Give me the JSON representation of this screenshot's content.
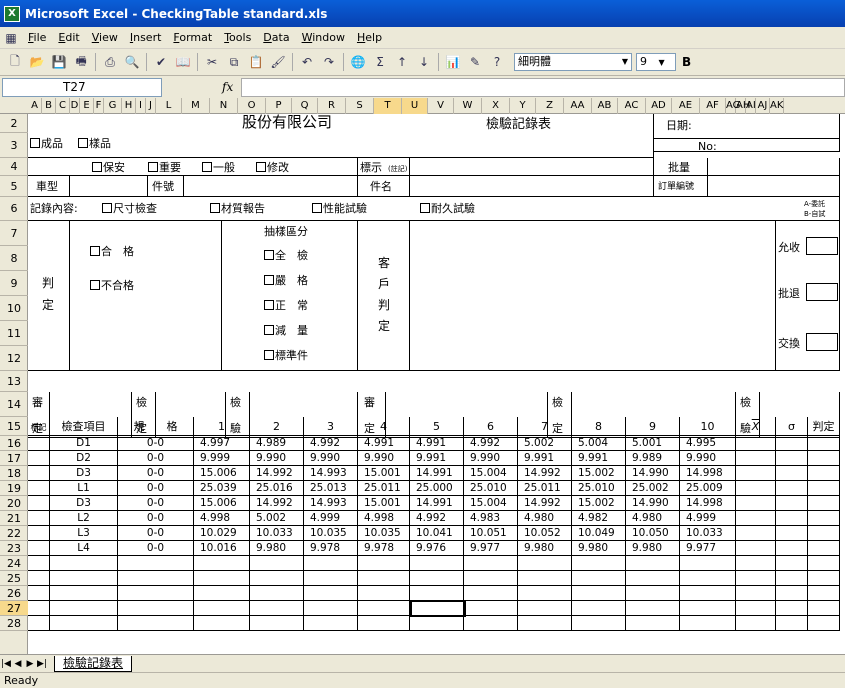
{
  "window": {
    "title": "Microsoft Excel - CheckingTable  standard.xls"
  },
  "menu": [
    "File",
    "Edit",
    "View",
    "Insert",
    "Format",
    "Tools",
    "Data",
    "Window",
    "Help"
  ],
  "toolbar": {
    "font": "細明體",
    "size": "9",
    "bold_label": "B"
  },
  "formula": {
    "cell_ref": "T27",
    "fx_label": "fx"
  },
  "columns": [
    "A",
    "B",
    "C",
    "D",
    "E",
    "F",
    "G",
    "H",
    "I",
    "J",
    "L",
    "M",
    "N",
    "O",
    "P",
    "Q",
    "R",
    "S",
    "T",
    "U",
    "V",
    "W",
    "X",
    "Y",
    "Z",
    "AA",
    "AB",
    "AC",
    "AD",
    "AE",
    "AF",
    "AG",
    "AH",
    "AI",
    "AJ",
    "AK"
  ],
  "rows": [
    "2",
    "3",
    "4",
    "5",
    "6",
    "7",
    "8",
    "9",
    "10",
    "11",
    "12",
    "13",
    "14",
    "15",
    "16",
    "17",
    "18",
    "19",
    "20",
    "21",
    "22",
    "23",
    "24",
    "25",
    "26",
    "27",
    "28"
  ],
  "form": {
    "company": "股份有限公司",
    "form_title": "檢驗記錄表",
    "date_label": "日期:",
    "no_label": "No:",
    "finished": "成品",
    "sample": "樣品",
    "safety": "保安",
    "important": "重要",
    "general": "一般",
    "modify": "修改",
    "mark_label": "標示",
    "mark_sub": "(註記)",
    "batch": "批量",
    "car_model": "車型",
    "part_no": "件號",
    "part_name": "件名",
    "order_no": "訂單編號",
    "record_content": "記錄內容:",
    "dim_check": "尺寸檢查",
    "material_report": "材質報告",
    "performance_test": "性能試驗",
    "durability_test": "耐久試驗",
    "note_a": "A-委託",
    "note_b": "B-自試",
    "judge": [
      "判",
      "定"
    ],
    "pass": "合　格",
    "fail": "不合格",
    "sampling": "抽樣區分",
    "s_full": "全　檢",
    "s_strict": "嚴　格",
    "s_normal": "正　常",
    "s_reduce": "減　量",
    "s_standard": "標準件",
    "customer": [
      "客",
      "戶",
      "判",
      "定"
    ],
    "accept": "允收",
    "reject": "批退",
    "exchange": "交換",
    "review": [
      "審",
      "定"
    ],
    "inspect": [
      "檢",
      "定"
    ],
    "verify": [
      "檢",
      "驗"
    ],
    "review2": [
      "審",
      "定"
    ],
    "inspect2": [
      "檢",
      "定"
    ],
    "verify2": [
      "檢",
      "驗"
    ]
  },
  "table": {
    "headers": [
      "標記",
      "檢查項目",
      "規　　格",
      "1",
      "2",
      "3",
      "4",
      "5",
      "6",
      "7",
      "8",
      "9",
      "10",
      "X",
      "σ",
      "判定"
    ],
    "rows": [
      {
        "item": "D1",
        "spec": "0-0",
        "v": [
          "4.997",
          "4.989",
          "4.992",
          "4.991",
          "4.991",
          "4.992",
          "5.002",
          "5.004",
          "5.001",
          "4.995"
        ]
      },
      {
        "item": "D2",
        "spec": "0-0",
        "v": [
          "9.999",
          "9.990",
          "9.990",
          "9.990",
          "9.991",
          "9.990",
          "9.991",
          "9.991",
          "9.989",
          "9.990"
        ]
      },
      {
        "item": "D3",
        "spec": "0-0",
        "v": [
          "15.006",
          "14.992",
          "14.993",
          "15.001",
          "14.991",
          "15.004",
          "14.992",
          "15.002",
          "14.990",
          "14.998"
        ]
      },
      {
        "item": "L1",
        "spec": "0-0",
        "v": [
          "25.039",
          "25.016",
          "25.013",
          "25.011",
          "25.000",
          "25.010",
          "25.011",
          "25.010",
          "25.002",
          "25.009"
        ]
      },
      {
        "item": "D3",
        "spec": "0-0",
        "v": [
          "15.006",
          "14.992",
          "14.993",
          "15.001",
          "14.991",
          "15.004",
          "14.992",
          "15.002",
          "14.990",
          "14.998"
        ]
      },
      {
        "item": "L2",
        "spec": "0-0",
        "v": [
          "4.998",
          "5.002",
          "4.999",
          "4.998",
          "4.992",
          "4.983",
          "4.980",
          "4.982",
          "4.980",
          "4.999"
        ]
      },
      {
        "item": "L3",
        "spec": "0-0",
        "v": [
          "10.029",
          "10.033",
          "10.035",
          "10.035",
          "10.041",
          "10.051",
          "10.052",
          "10.049",
          "10.050",
          "10.033"
        ]
      },
      {
        "item": "L4",
        "spec": "0-0",
        "v": [
          "10.016",
          "9.980",
          "9.978",
          "9.978",
          "9.976",
          "9.977",
          "9.980",
          "9.980",
          "9.980",
          "9.977"
        ]
      }
    ]
  },
  "sheet_tab": "檢驗記錄表",
  "status": "Ready"
}
